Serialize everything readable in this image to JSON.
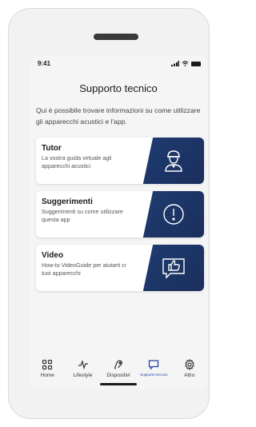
{
  "status": {
    "time": "9:41"
  },
  "header": {
    "title": "Supporto tecnico"
  },
  "intro": "Qui è possibile trovare informazioni su come utilizzare gli apparecchi acustici e l'app.",
  "cards": [
    {
      "title": "Tutor",
      "description": "La vostra guida virtuale agli apparecchi acustici",
      "icon": "tutor-icon"
    },
    {
      "title": "Suggerimenti",
      "description": "Suggerimenti su come utilizzare questa app",
      "icon": "exclamation-icon"
    },
    {
      "title": "Video",
      "description": "How-to VideoGuide per aiutarti con i tuoi apparecchi",
      "icon": "thumbs-up-chat-icon"
    }
  ],
  "tabs": [
    {
      "label": "Home",
      "icon": "grid-icon"
    },
    {
      "label": "Lifestyle",
      "icon": "pulse-icon"
    },
    {
      "label": "Dispositivi",
      "icon": "hearing-aid-icon"
    },
    {
      "label": "Supporto tecnico",
      "icon": "chat-icon",
      "active": true
    },
    {
      "label": "Altro",
      "icon": "gear-icon"
    }
  ],
  "colors": {
    "accent": "#2346a0",
    "card_art": "#1e3c72"
  }
}
